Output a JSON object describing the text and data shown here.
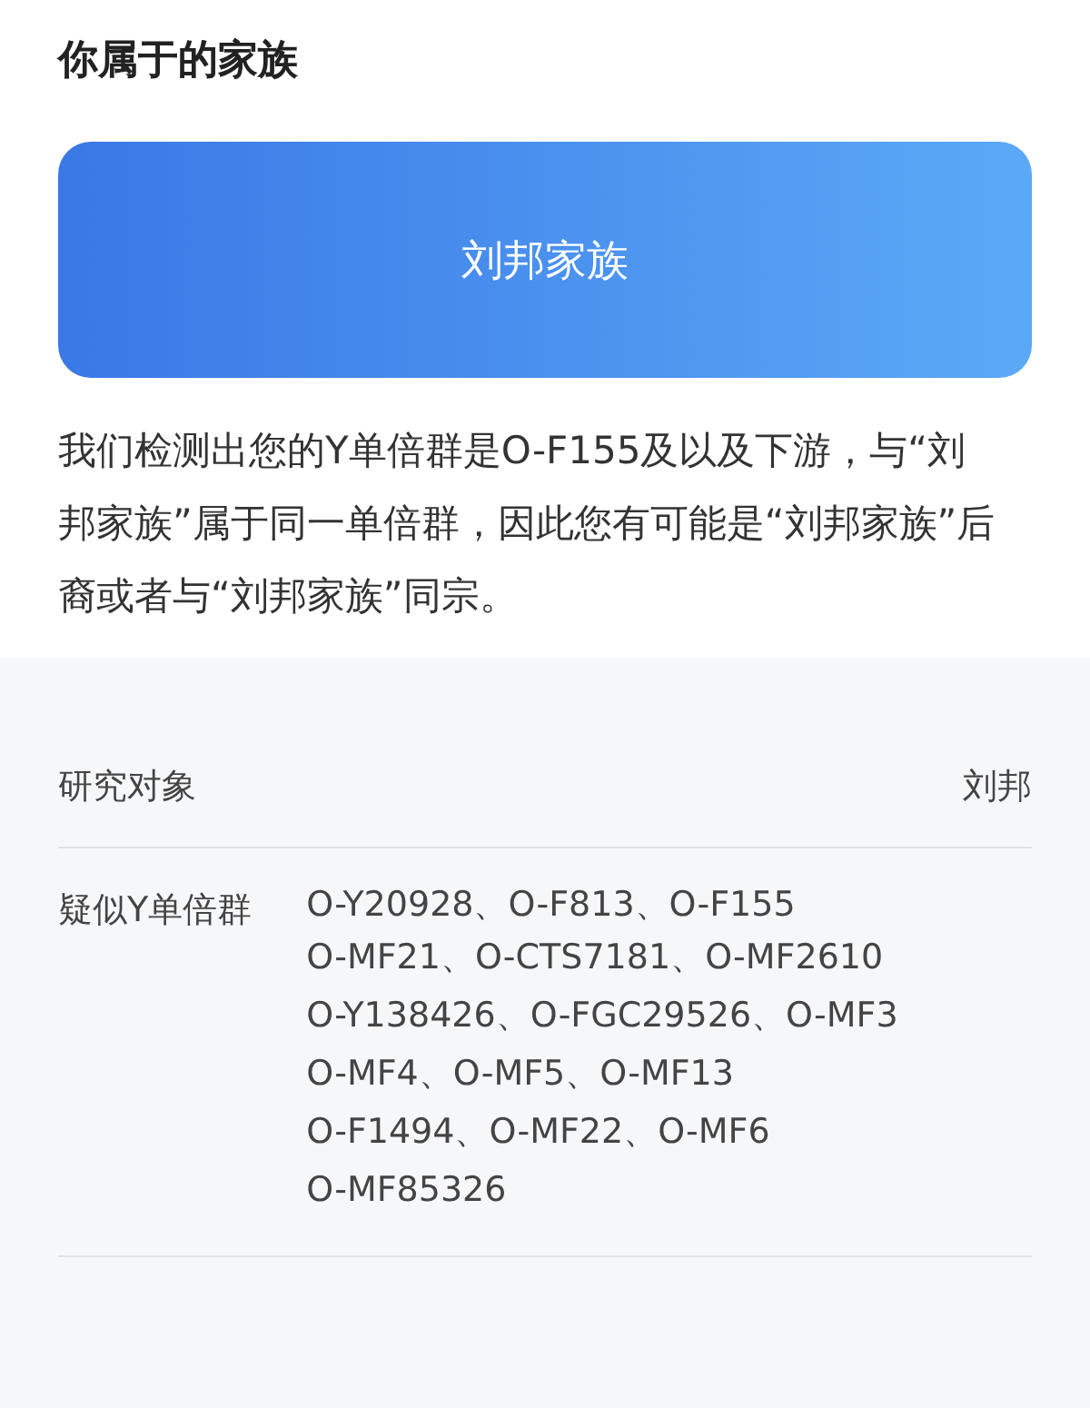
{
  "section_title": "你属于的家族",
  "family_card": {
    "name": "刘邦家族"
  },
  "description": "我们检测出您的Y单倍群是O-F155及以及下游，与“刘邦家族”属于同一单倍群，因此您有可能是“刘邦家族”后裔或者与“刘邦家族”同宗。",
  "details": [
    {
      "label": "研究对象",
      "values": [
        "刘邦"
      ]
    },
    {
      "label": "疑似Y单倍群",
      "values": [
        "O-Y20928、O-F813、O-F155",
        "O-MF21、O-CTS7181、O-MF2610",
        "O-Y138426、O-FGC29526、O-MF3",
        "O-MF4、O-MF5、O-MF13",
        "O-F1494、O-MF22、O-MF6",
        "O-MF85326"
      ]
    }
  ]
}
